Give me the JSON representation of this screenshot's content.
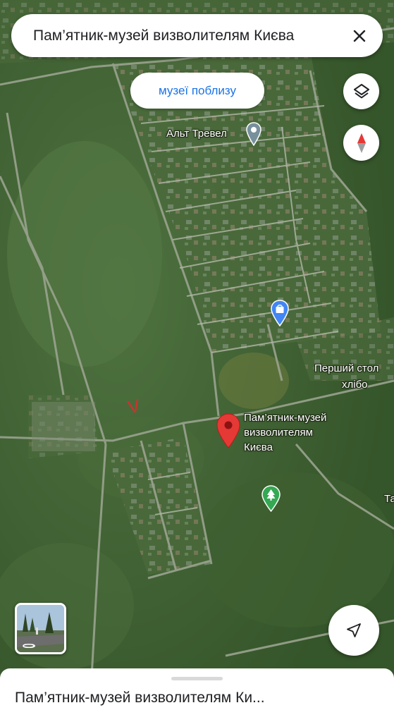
{
  "search": {
    "query": "Пам’ятник-музей визволителям Києва"
  },
  "chip": {
    "label": "музеї поблизу"
  },
  "map": {
    "labels": {
      "alt_travel": "Альт Тревел",
      "bakery_line1": "Перший стол",
      "bakery_line2": "хлібо",
      "museum_line1": "Пам’ятник-музей",
      "museum_line2": "визволителям",
      "museum_line3": "Києва",
      "partial": "Та"
    },
    "annotation": "V"
  },
  "sheet": {
    "title": "Пам’ятник-музей визволителям Ки..."
  },
  "icons": {
    "close": "close-icon",
    "layers": "layers-icon",
    "compass": "compass-icon",
    "locate": "navigation-arrow-icon",
    "street_view": "street-view-icon"
  },
  "colors": {
    "accent": "#1a73e8",
    "pin_red": "#e53935",
    "poi_blue": "#4285f4",
    "park_green": "#34a853",
    "poi_gray": "#78909c"
  }
}
